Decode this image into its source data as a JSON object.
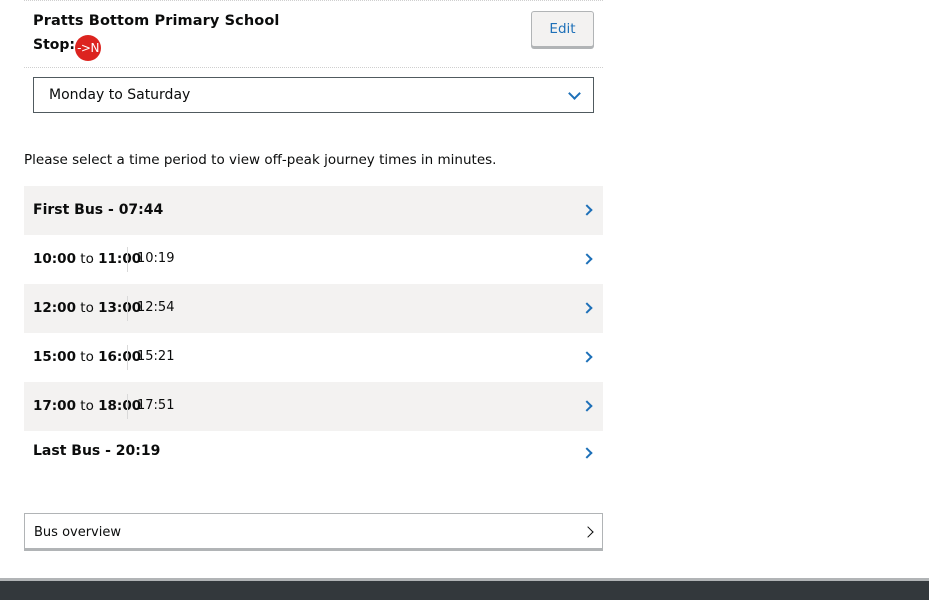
{
  "stop": {
    "name": "Pratts Bottom Primary School",
    "label": "Stop:",
    "badge": "->N",
    "edit_label": "Edit"
  },
  "day_select": {
    "selected": "Monday to Saturday"
  },
  "instruction": "Please select a time period to view off-peak journey times in minutes.",
  "first_bus": "First Bus - 07:44",
  "periods": [
    {
      "from": "10:00",
      "to_word": "to",
      "to": "11:00",
      "times": "10:19"
    },
    {
      "from": "12:00",
      "to_word": "to",
      "to": "13:00",
      "times": "12:54"
    },
    {
      "from": "15:00",
      "to_word": "to",
      "to": "16:00",
      "times": "15:21"
    },
    {
      "from": "17:00",
      "to_word": "to",
      "to": "18:00",
      "times": "17:51"
    }
  ],
  "last_bus": "Last Bus - 20:19",
  "overview_label": "Bus overview",
  "colors": {
    "link_blue": "#1d70b8",
    "stop_red": "#dc241f",
    "row_grey": "#f3f2f1",
    "footer_dark": "#33383c"
  }
}
